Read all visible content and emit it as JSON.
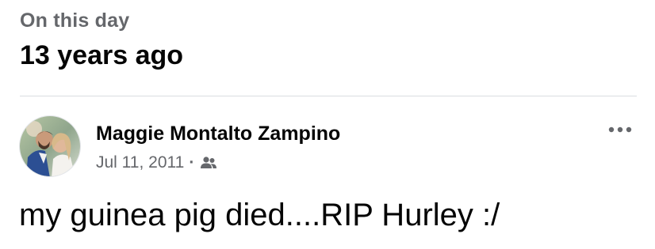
{
  "memory": {
    "label": "On this day",
    "age": "13 years ago"
  },
  "post": {
    "author": "Maggie Montalto Zampino",
    "date": "Jul 11, 2011",
    "separator": "·",
    "audience_icon": "friends-icon",
    "more_icon": "more-options-icon",
    "text": "my guinea pig died....RIP Hurley :/"
  },
  "colors": {
    "primary_text": "#050505",
    "secondary_text": "#65676b",
    "divider": "#dadde1"
  }
}
